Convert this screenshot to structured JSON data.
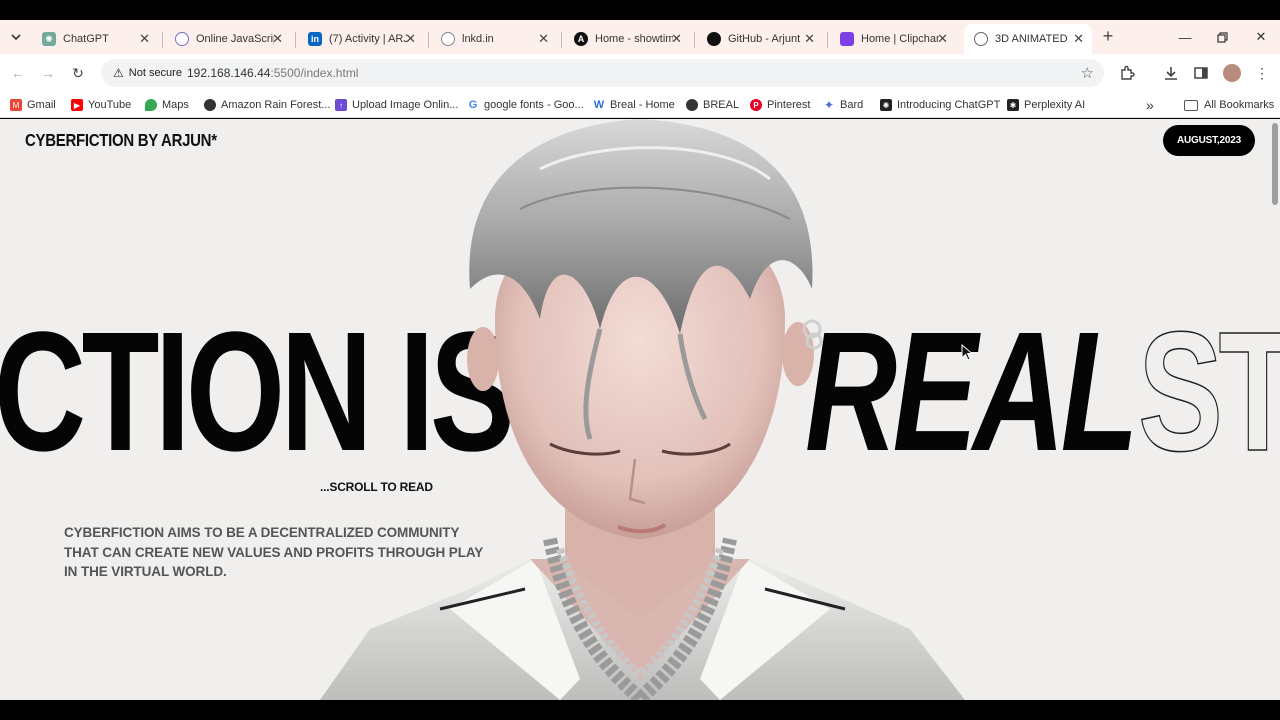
{
  "browser": {
    "tabs": [
      {
        "label": "ChatGPT",
        "icon": "chatgpt-icon",
        "color": "#74aa9c"
      },
      {
        "label": "Online JavaScrip",
        "icon": "js-icon",
        "color": "#7c6cc8"
      },
      {
        "label": "(7) Activity | ARJ",
        "icon": "linkedin-icon",
        "color": "#0a66c2"
      },
      {
        "label": "lnkd.in",
        "icon": "globe-icon",
        "color": "#888888"
      },
      {
        "label": "Home - showtim",
        "icon": "a-logo-icon",
        "color": "#111111"
      },
      {
        "label": "GitHub - Arjunt",
        "icon": "github-icon",
        "color": "#111111"
      },
      {
        "label": "Home | Clipchan",
        "icon": "clipchamp-icon",
        "color": "#7b3fe4"
      },
      {
        "label": "3D ANIMATED",
        "icon": "globe-icon",
        "color": "#666666"
      }
    ],
    "new_tab": "+",
    "address": {
      "not_secure": "Not secure",
      "host": "192.168.146.44",
      "port_path": ":5500/index.html"
    },
    "bookmarks": [
      {
        "label": "Gmail",
        "icon": "gmail-icon",
        "color": "#ea4335"
      },
      {
        "label": "YouTube",
        "icon": "youtube-icon",
        "color": "#ff0000"
      },
      {
        "label": "Maps",
        "icon": "maps-icon",
        "color": "#34a853"
      },
      {
        "label": "Amazon Rain Forest...",
        "icon": "globe-icon",
        "color": "#333333"
      },
      {
        "label": "Upload Image Onlin...",
        "icon": "upload-icon",
        "color": "#6c4ad6"
      },
      {
        "label": "google fonts - Goo...",
        "icon": "google-icon",
        "color": "#4285f4"
      },
      {
        "label": "Breal - Home",
        "icon": "breal-icon",
        "color": "#2f6fd6"
      },
      {
        "label": "BREAL",
        "icon": "globe-icon",
        "color": "#333333"
      },
      {
        "label": "Pinterest",
        "icon": "pinterest-icon",
        "color": "#e60023"
      },
      {
        "label": "Bard",
        "icon": "bard-icon",
        "color": "#4b6bdc"
      },
      {
        "label": "Introducing ChatGPT",
        "icon": "chatgpt-icon",
        "color": "#222222"
      },
      {
        "label": "Perplexity AI",
        "icon": "perplexity-icon",
        "color": "#222222"
      }
    ],
    "more_bookmarks": "»",
    "all_bookmarks": "All Bookmarks"
  },
  "page": {
    "brand": "CYBERFICTION BY ARJUN*",
    "date": "AUGUST,2023",
    "headline_left": "CTION IS",
    "headline_real": "REAL",
    "headline_outline": "ST",
    "scroll_hint": "...SCROLL TO READ",
    "description": "CYBERFICTION AIMS TO BE A DECENTRALIZED COMMUNITY THAT CAN CREATE NEW VALUES AND PROFITS THROUGH PLAY IN THE VIRTUAL WORLD."
  }
}
